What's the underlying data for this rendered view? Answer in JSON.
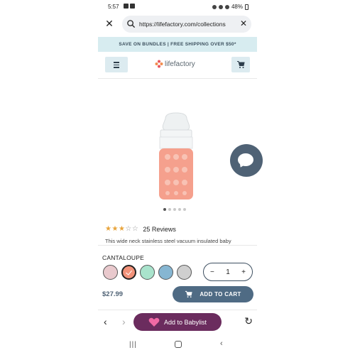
{
  "status_bar": {
    "time": "5:57",
    "battery": "48%"
  },
  "url_bar": {
    "url": "https://lifefactory.com/collections"
  },
  "promo": {
    "text": "SAVE ON BUNDLES | FREE SHIPPING OVER $50*"
  },
  "header": {
    "logo_text": "lifefactory"
  },
  "gallery": {
    "slide_count": 5,
    "active_slide": 1
  },
  "rating": {
    "stars": 3,
    "max_stars": 5,
    "reviews_label": "25 Reviews"
  },
  "description": "This wide neck stainless steel vacuum insulated baby",
  "color": {
    "label": "CANTALOUPE",
    "swatches": [
      {
        "name": "pink",
        "hex": "#e9c9cd"
      },
      {
        "name": "cantaloupe",
        "hex": "#f2927a"
      },
      {
        "name": "mint",
        "hex": "#a9e3cc"
      },
      {
        "name": "blue",
        "hex": "#86b6d2"
      },
      {
        "name": "gray",
        "hex": "#cfcfcf"
      }
    ],
    "selected_index": 1
  },
  "quantity": {
    "value": "1",
    "minus": "−",
    "plus": "+"
  },
  "price": "$27.99",
  "add_to_cart": "ADD TO CART",
  "bottom_bar": {
    "babylist_label": "Add to Babylist"
  },
  "colors": {
    "accent": "#4f6b84",
    "babylist": "#6b2c5e",
    "promo_bg": "#d7ecf0",
    "sleeve": "#f5a08d"
  }
}
